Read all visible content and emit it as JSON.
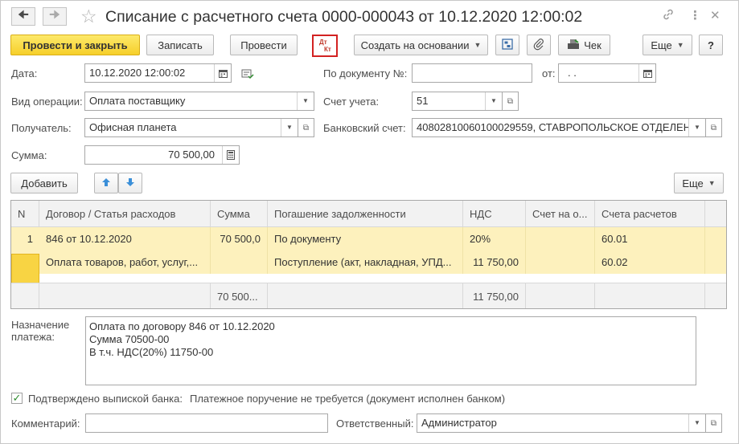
{
  "header": {
    "title": "Списание с расчетного счета 0000-000043 от 10.12.2020 12:00:02",
    "back_icon": "arrow-left-icon",
    "forward_icon": "arrow-right-icon",
    "favorite_icon": "star-icon",
    "link_icon": "link-icon",
    "more_icon": "more-vertical-icon",
    "close_icon": "close-icon"
  },
  "toolbar": {
    "post_close": "Провести и закрыть",
    "save": "Записать",
    "post": "Провести",
    "dtkt_d": "Дт",
    "dtkt_k": "Кт",
    "create_based": "Создать на основании",
    "receipt": "Чек",
    "more": "Еще",
    "help": "?"
  },
  "form": {
    "date_label": "Дата:",
    "date_value": "10.12.2020 12:00:02",
    "doc_num_label": "По документу №:",
    "doc_num_value": "",
    "from_label": "от:",
    "from_value": ".  .",
    "op_type_label": "Вид операции:",
    "op_type_value": "Оплата поставщику",
    "account_label": "Счет учета:",
    "account_value": "51",
    "recipient_label": "Получатель:",
    "recipient_value": "Офисная планета",
    "bank_account_label": "Банковский счет:",
    "bank_account_value": "40802810060100029559, СТАВРОПОЛЬСКОЕ ОТДЕЛЕН",
    "sum_label": "Сумма:",
    "sum_value": "70 500,00"
  },
  "table_toolbar": {
    "add": "Добавить",
    "more": "Еще"
  },
  "table": {
    "columns": [
      "N",
      "Договор / Статья расходов",
      "Сумма",
      "Погашение задолженности",
      "НДС",
      "Счет на о...",
      "Счета расчетов"
    ],
    "row": {
      "n": "1",
      "contract": "846 от 10.12.2020",
      "expense": "Оплата товаров, работ, услуг,...",
      "sum": "70 500,0",
      "repay": "По документу",
      "repay_doc": "Поступление (акт, накладная, УПД...",
      "vat_rate": "20%",
      "vat_sum": "11 750,00",
      "account_1": "60.01",
      "account_2": "60.02"
    },
    "footer": {
      "sum": "70 500...",
      "vat": "11 750,00"
    }
  },
  "purpose": {
    "label_1": "Назначение",
    "label_2": "платежа:",
    "line_1": "Оплата по договору 846 от 10.12.2020",
    "line_2": "Сумма 70500-00",
    "line_3": "В т.ч. НДС(20%) 11750-00"
  },
  "confirmation": {
    "checked": true,
    "label": "Подтверждено выпиской банка:",
    "note": "Платежное поручение не требуется (документ исполнен банком)"
  },
  "bottom": {
    "comment_label": "Комментарий:",
    "comment_value": "",
    "responsible_label": "Ответственный:",
    "responsible_value": "Администратор"
  }
}
